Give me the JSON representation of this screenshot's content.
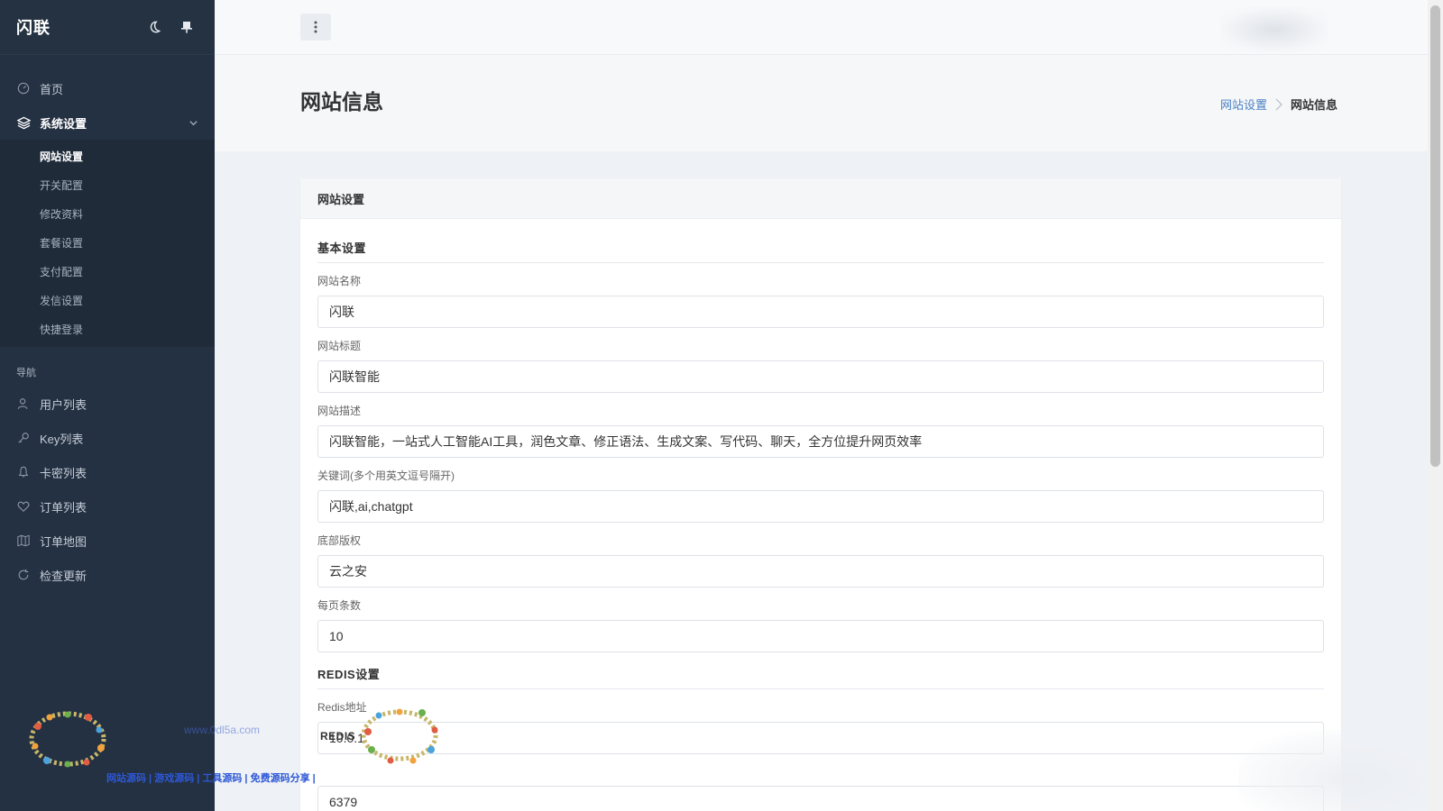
{
  "app": {
    "brand": "闪联"
  },
  "sidebar": {
    "menu": [
      {
        "label": "首页",
        "icon": "dashboard-icon"
      },
      {
        "label": "系统设置",
        "icon": "layers-icon",
        "expanded": true
      }
    ],
    "submenu": [
      {
        "label": "网站设置",
        "current": true
      },
      {
        "label": "开关配置"
      },
      {
        "label": "修改资料"
      },
      {
        "label": "套餐设置"
      },
      {
        "label": "支付配置"
      },
      {
        "label": "发信设置"
      },
      {
        "label": "快捷登录"
      }
    ],
    "nav_heading": "导航",
    "nav": [
      {
        "label": "用户列表",
        "icon": "users-icon"
      },
      {
        "label": "Key列表",
        "icon": "key-icon"
      },
      {
        "label": "卡密列表",
        "icon": "bell-icon"
      },
      {
        "label": "订单列表",
        "icon": "heart-icon"
      },
      {
        "label": "订单地图",
        "icon": "map-icon"
      },
      {
        "label": "检查更新",
        "icon": "refresh-icon"
      }
    ]
  },
  "header": {
    "title": "网站信息",
    "breadcrumb": {
      "parent": "网站设置",
      "current": "网站信息"
    }
  },
  "card": {
    "title": "网站设置",
    "basic_section": "基本设置",
    "fields": {
      "site_name": {
        "label": "网站名称",
        "value": "闪联"
      },
      "site_title": {
        "label": "网站标题",
        "value": "闪联智能"
      },
      "site_desc": {
        "label": "网站描述",
        "value": "闪联智能，一站式人工智能AI工具，润色文章、修正语法、生成文案、写代码、聊天，全方位提升网页效率"
      },
      "keywords": {
        "label": "关键词(多个用英文逗号隔开)",
        "value": "闪联,ai,chatgpt"
      },
      "copyright": {
        "label": "底部版权",
        "value": "云之安"
      },
      "per_page": {
        "label": "每页条数",
        "value": "10"
      }
    },
    "redis_section": "REDIS设置",
    "redis": {
      "address": {
        "label": "Redis地址",
        "value": "10.0.1"
      },
      "port": {
        "value": "6379"
      }
    }
  },
  "watermark": {
    "url": "www.0dl5a.com",
    "tagline": "网站源码 | 游戏源码 | 工具源码 | 免费源码分享 |",
    "mid_text": "REDIS"
  }
}
